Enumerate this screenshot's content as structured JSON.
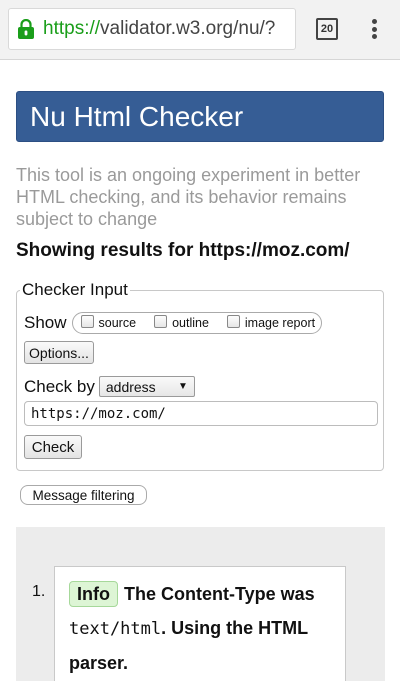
{
  "browser": {
    "url_scheme": "https://",
    "url_rest": "validator.w3.org/nu/?",
    "tab_count": "20"
  },
  "page": {
    "title": "Nu Html Checker",
    "intro": "This tool is an ongoing experiment in better HTML checking, and its behavior remains subject to change",
    "showing": "Showing results for https://moz.com/"
  },
  "form": {
    "legend": "Checker Input",
    "show_label": "Show",
    "show_options": [
      "source",
      "outline",
      "image report"
    ],
    "options_button": "Options...",
    "checkby_label": "Check by",
    "checkby_value": "address",
    "address_value": "https://moz.com/",
    "check_button": "Check",
    "message_filtering": "Message filtering"
  },
  "results": {
    "item_number": "1.",
    "badge": "Info",
    "message_before": "The Content-Type was",
    "message_code": "text/html",
    "message_after": ". Using the HTML parser."
  },
  "colors": {
    "banner": "#365d95",
    "url_scheme": "#1a9e1a",
    "info_badge": "#ddf5d5"
  }
}
